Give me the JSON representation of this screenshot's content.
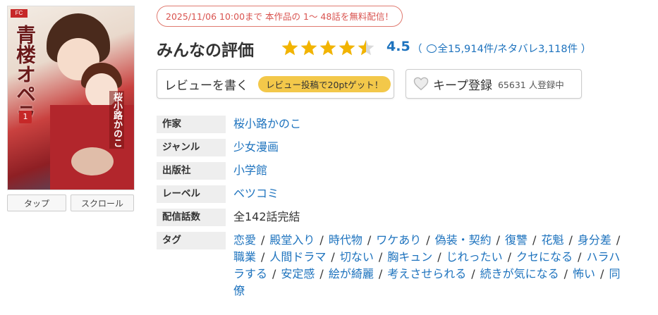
{
  "cover": {
    "publisher_logo": "FC",
    "title_vertical": "青楼オペラ",
    "volume": "1",
    "author_vertical": "桜小路かのこ"
  },
  "viewer_modes": [
    "タップ",
    "スクロール"
  ],
  "promo": "2025/11/06 10:00まで 本作品の 1～ 48話を無料配信！",
  "rating": {
    "title": "みんなの評価",
    "score": "4.5",
    "star_value": 4.5,
    "star_max": 5,
    "count_prefix": "（",
    "count_text": "全15,914件/ネタバレ3,118件 ）",
    "star_color": "#f2b400",
    "link_color": "#1e73be"
  },
  "actions": {
    "review_label": "レビューを書く",
    "review_badge": "レビュー投稿で20ptゲット！",
    "keep_label": "キープ登録",
    "keep_count": "65631 人登録中"
  },
  "info": {
    "author_key": "作家",
    "author": "桜小路かのこ",
    "genre_key": "ジャンル",
    "genre": "少女漫画",
    "publisher_key": "出版社",
    "publisher": "小学館",
    "label_key": "レーベル",
    "label": "ベツコミ",
    "episodes_key": "配信話数",
    "episodes": "全142話完結",
    "tags_key": "タグ",
    "tags": [
      "恋愛",
      "殿堂入り",
      "時代物",
      "ワケあり",
      "偽装・契約",
      "復讐",
      "花魁",
      "身分差",
      "職業",
      "人間ドラマ",
      "切ない",
      "胸キュン",
      "じれったい",
      "クセになる",
      "ハラハラする",
      "安定感",
      "絵が綺麗",
      "考えさせられる",
      "続きが気になる",
      "怖い",
      "同僚"
    ],
    "tag_separator": "/"
  }
}
